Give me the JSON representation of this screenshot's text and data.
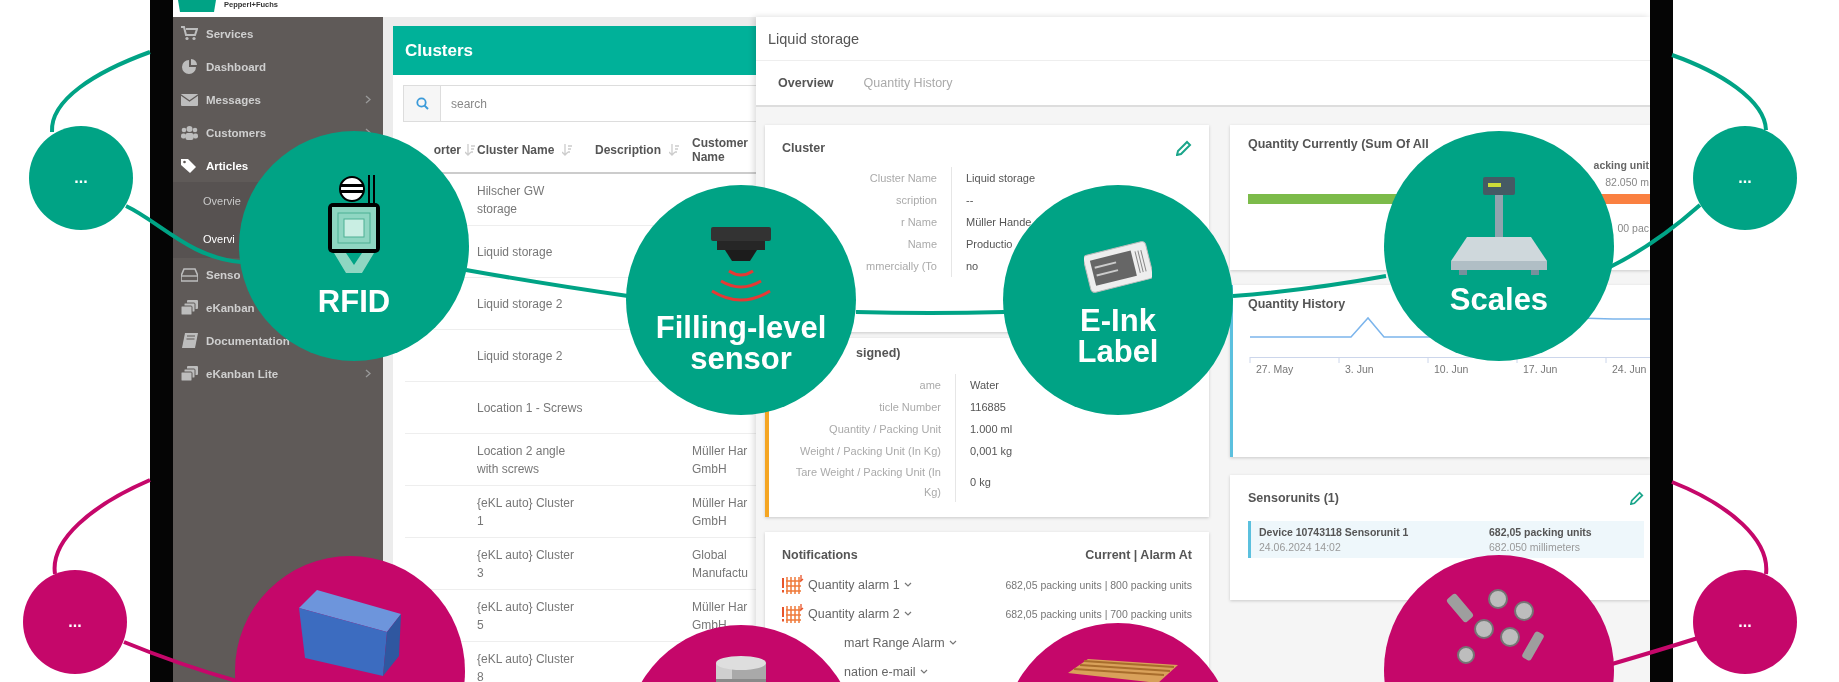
{
  "logo": {
    "text": "Pepperl+Fuchs"
  },
  "sidebar": {
    "items": [
      {
        "label": "Services",
        "selected": false,
        "submenu": false
      },
      {
        "label": "Dashboard",
        "selected": false,
        "submenu": false
      },
      {
        "label": "Messages",
        "selected": false,
        "submenu": true
      },
      {
        "label": "Customers",
        "selected": false,
        "submenu": true
      },
      {
        "label": "Articles",
        "selected": true,
        "submenu": false,
        "children": [
          {
            "label": "Overvie",
            "selected": false
          },
          {
            "label": "Overvi",
            "selected": true
          }
        ]
      },
      {
        "label": "Senso",
        "selected": false
      },
      {
        "label": "eKanban",
        "selected": false
      },
      {
        "label": "Documentation",
        "selected": false
      },
      {
        "label": "eKanban Lite",
        "selected": false,
        "submenu": true
      }
    ]
  },
  "clusters": {
    "title": "Clusters",
    "search": {
      "placeholder": "search"
    },
    "columns": [
      {
        "label": "orter",
        "sortable": true
      },
      {
        "label": "Cluster Name",
        "sortable": true
      },
      {
        "label": "Description",
        "sortable": true
      },
      {
        "label": "Customer Name",
        "sortable": false
      }
    ],
    "rows": [
      {
        "cluster_name": "Hilscher GW storage"
      },
      {
        "cluster_name": "Liquid storage"
      },
      {
        "cluster_name": "Liquid storage 2"
      },
      {
        "cluster_name": "Liquid storage 2"
      },
      {
        "cluster_name": "Location 1 - Screws"
      },
      {
        "cluster_name": "Location 2 angle with screws",
        "customer": "Müller Har GmbH"
      },
      {
        "cluster_name": "{eKL auto} Cluster 1",
        "customer": "Müller Har GmbH"
      },
      {
        "cluster_name": "{eKL auto} Cluster 3",
        "customer": "Global Manufactu"
      },
      {
        "cluster_name": "{eKL auto} Cluster 5",
        "customer": "Müller Har GmbH"
      },
      {
        "cluster_name": "{eKL auto} Cluster 8"
      }
    ]
  },
  "detail": {
    "title": "Liquid storage",
    "tabs": [
      {
        "label": "Overview",
        "selected": true
      },
      {
        "label": "Quantity History",
        "selected": false
      }
    ],
    "cluster_card": {
      "title": "Cluster",
      "fields": [
        {
          "label": "Cluster Name",
          "value": "Liquid storage"
        },
        {
          "label": "scription",
          "value": "--"
        },
        {
          "label": "r Name",
          "value": "Müller Hande"
        },
        {
          "label": "Name",
          "value": "Productio"
        },
        {
          "label": "mmercially (To",
          "value": "no"
        }
      ]
    },
    "article_card": {
      "title": "signed)",
      "fields": [
        {
          "label": "ame",
          "value": "Water"
        },
        {
          "label": "ticle Number",
          "value": "116885"
        },
        {
          "label": "Quantity / Packing Unit",
          "value": "1.000 ml"
        },
        {
          "label": "Weight / Packing Unit (In Kg)",
          "value": "0,001 kg"
        },
        {
          "label": "Tare Weight / Packing Unit (In Kg)",
          "value": "0 kg"
        }
      ]
    },
    "notifications": {
      "title": "Notifications",
      "column_header": "Current | Alarm At",
      "rows": [
        {
          "label": "Quantity alarm 1",
          "reading": "682,05 packing units | 800 packing units"
        },
        {
          "label": "Quantity alarm 2",
          "reading": "682,05 packing units | 700 packing units"
        },
        {
          "label": "mart Range Alarm"
        },
        {
          "label": "nation e-mail"
        }
      ]
    },
    "quantity_current": {
      "title": "Quantity Currently (Sum Of All",
      "unit_label": "acking unit",
      "amount": "82.050 m",
      "level": 0.85,
      "threshold": "00 pac"
    },
    "quantity_history": {
      "title": "Quantity History",
      "x_labels": [
        "27. May",
        "3. Jun",
        "10. Jun",
        "17. Jun",
        "24. Jun"
      ]
    },
    "sensorunits": {
      "title": "Sensorunits (1)",
      "units": [
        {
          "name": "Device 10743118 Sensorunit 1",
          "time": "24.06.2024 14:02",
          "quantity": "682,05 packing units",
          "reading": "682.050 millimeters"
        }
      ]
    }
  },
  "circles": [
    {
      "kind": "more",
      "label": "...",
      "color": "#00a385"
    },
    {
      "kind": "feature",
      "label": "RFID",
      "color": "#00a385"
    },
    {
      "kind": "feature",
      "label": "Filling-level sensor",
      "color": "#00a385"
    },
    {
      "kind": "feature",
      "label": "E-Ink Label",
      "color": "#00a385"
    },
    {
      "kind": "feature",
      "label": "Scales",
      "color": "#00a385"
    },
    {
      "kind": "more",
      "label": "...",
      "color": "#00a385"
    },
    {
      "kind": "more",
      "label": "...",
      "color": "#c5076a"
    },
    {
      "kind": "product",
      "color": "#c5076a"
    },
    {
      "kind": "product",
      "color": "#c5076a"
    },
    {
      "kind": "product",
      "color": "#c5076a"
    },
    {
      "kind": "product",
      "color": "#c5076a"
    },
    {
      "kind": "more",
      "label": "...",
      "color": "#c5076a"
    }
  ]
}
